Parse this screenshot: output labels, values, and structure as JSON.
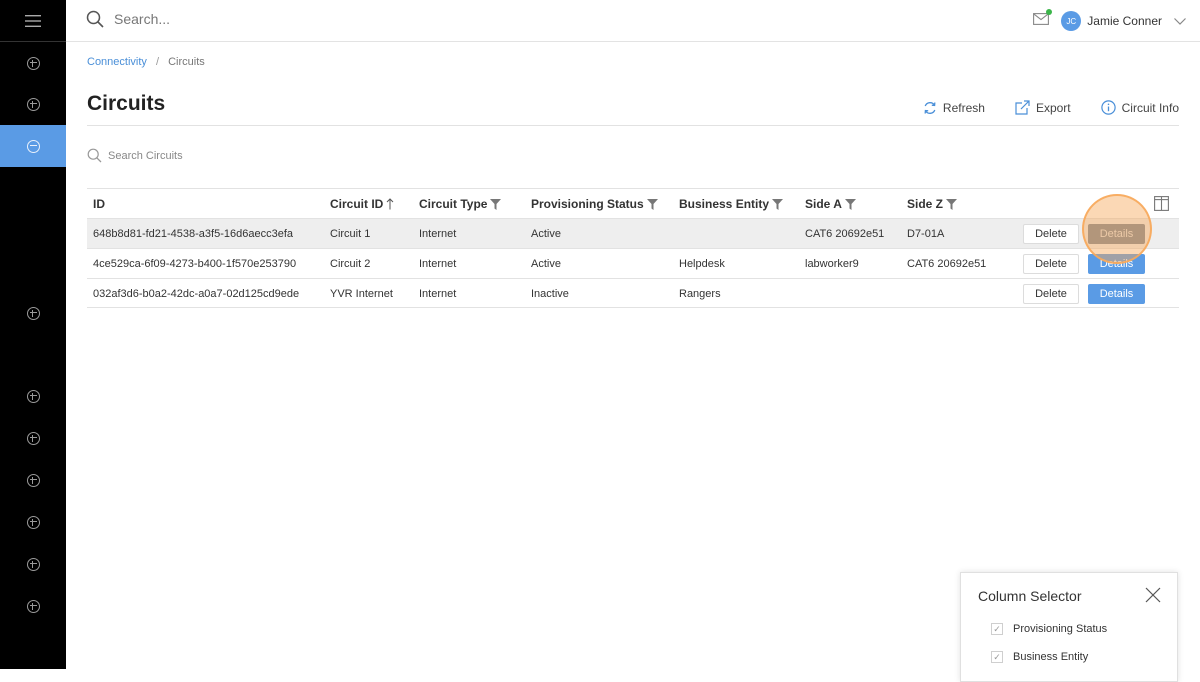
{
  "topbar": {
    "search_placeholder": "Search...",
    "user_initials": "JC",
    "user_name": "Jamie Conner"
  },
  "breadcrumb": {
    "root": "Connectivity",
    "separator": "/",
    "current": "Circuits"
  },
  "page": {
    "title": "Circuits",
    "actions": {
      "refresh": "Refresh",
      "export": "Export",
      "info": "Circuit Info"
    },
    "table_search_placeholder": "Search Circuits"
  },
  "table": {
    "headers": {
      "id": "ID",
      "circuit_id": "Circuit ID",
      "circuit_type": "Circuit Type",
      "provisioning_status": "Provisioning Status",
      "business_entity": "Business Entity",
      "side_a": "Side A",
      "side_z": "Side Z"
    },
    "delete_label": "Delete",
    "details_label": "Details",
    "rows": [
      {
        "id": "648b8d81-fd21-4538-a3f5-16d6aecc3efa",
        "circuit_id": "Circuit 1",
        "circuit_type": "Internet",
        "provisioning_status": "Active",
        "business_entity": "",
        "side_a": "CAT6 20692e51",
        "side_z": "D7-01A"
      },
      {
        "id": "4ce529ca-6f09-4273-b400-1f570e253790",
        "circuit_id": "Circuit 2",
        "circuit_type": "Internet",
        "provisioning_status": "Active",
        "business_entity": "Helpdesk",
        "side_a": "labworker9",
        "side_z": "CAT6 20692e51"
      },
      {
        "id": "032af3d6-b0a2-42dc-a0a7-02d125cd9ede",
        "circuit_id": "YVR Internet",
        "circuit_type": "Internet",
        "provisioning_status": "Inactive",
        "business_entity": "Rangers",
        "side_a": "",
        "side_z": ""
      }
    ]
  },
  "column_selector": {
    "title": "Column Selector",
    "options": [
      "Provisioning Status",
      "Business Entity"
    ]
  },
  "colors": {
    "sidebar_bg": "#000000",
    "active_nav": "#5a9be5",
    "accent_link": "#4a8fd8",
    "details_button": "#5a9be5",
    "highlight": "#f7a85a",
    "status_dot": "#3bb54a"
  },
  "icons": {
    "menu": "hamburger-icon",
    "search": "search-icon",
    "mail": "mail-icon",
    "refresh": "refresh-icon",
    "export": "export-icon",
    "info": "info-icon",
    "filter": "filter-icon",
    "sort": "sort-up-icon",
    "columns": "columns-icon",
    "close": "close-icon",
    "nav_add": "plus-circle-icon",
    "nav_active": "minus-circle-icon"
  }
}
